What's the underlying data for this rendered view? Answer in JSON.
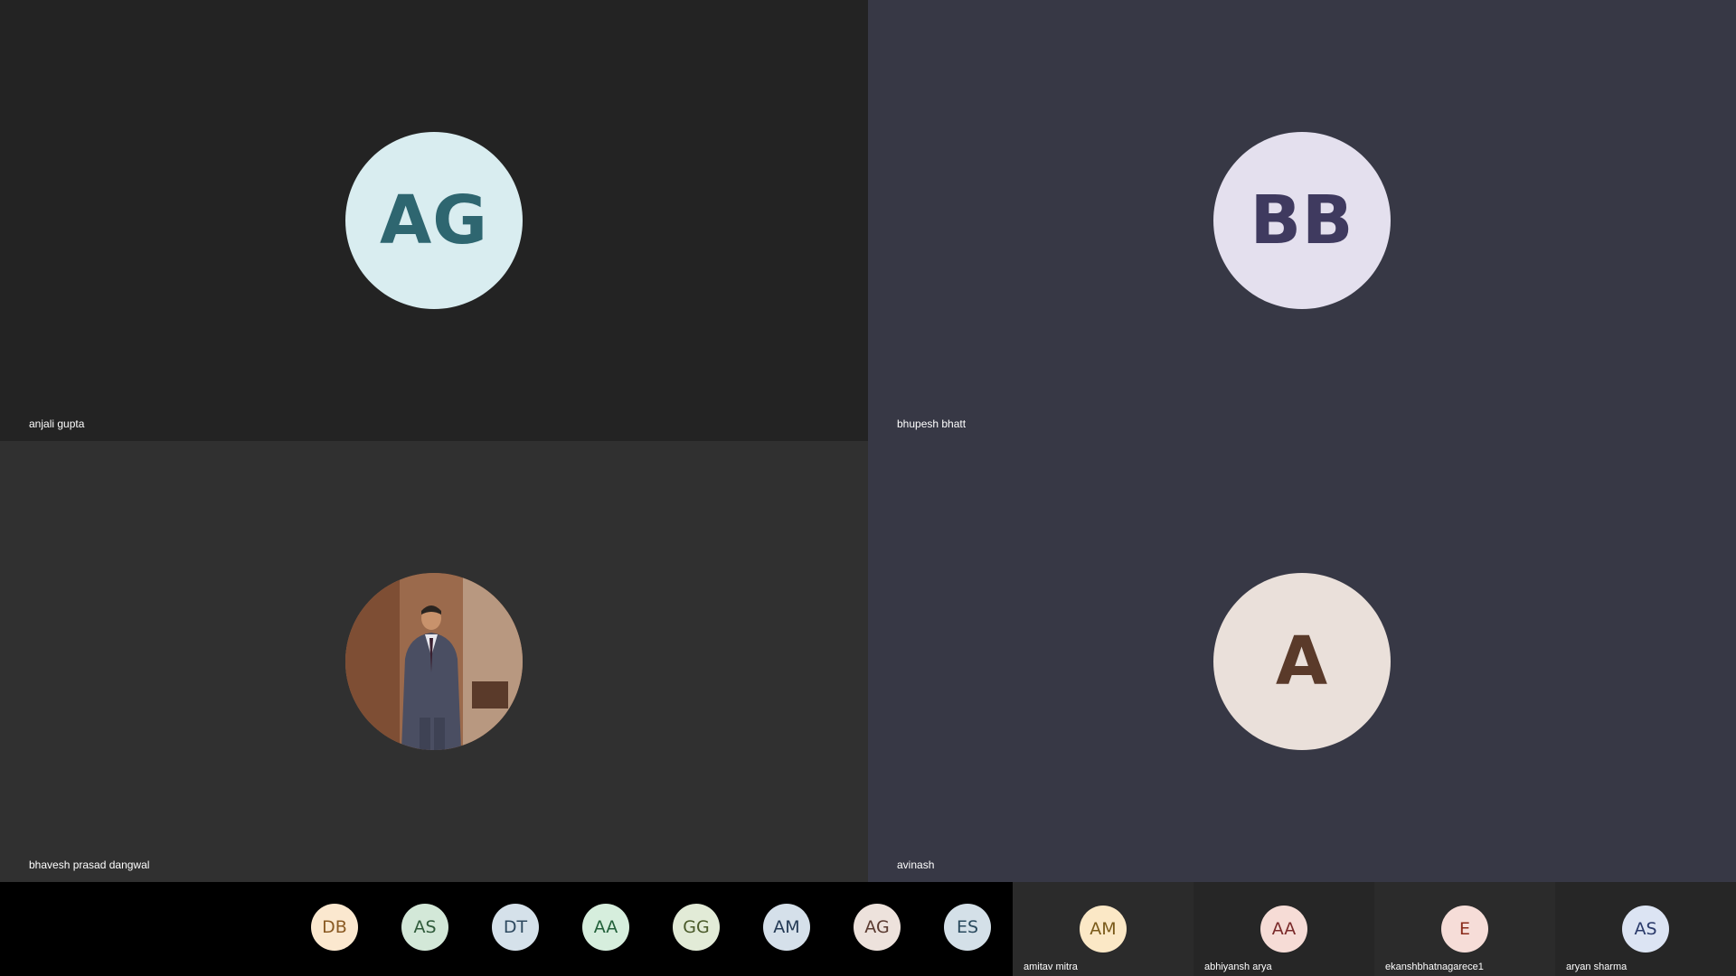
{
  "tiles": [
    {
      "name": "anjali gupta",
      "initials": "AG",
      "avatar_bg": "#d9edf0",
      "avatar_fg": "#2e6670",
      "tile_bg": "#232323"
    },
    {
      "name": "bhupesh bhatt",
      "initials": "BB",
      "avatar_bg": "#e4e0ee",
      "avatar_fg": "#3f3a5f",
      "tile_bg": "#373845"
    },
    {
      "name": "bhavesh prasad dangwal",
      "initials": "",
      "avatar_type": "photo",
      "tile_bg": "#303030"
    },
    {
      "name": "avinash",
      "initials": "A",
      "avatar_bg": "#eae0da",
      "avatar_fg": "#5a3a2a",
      "tile_bg": "#373845"
    }
  ],
  "overflow_avatars": [
    {
      "initials": "DB",
      "bg": "#fbe8cf",
      "fg": "#8a5a23"
    },
    {
      "initials": "AS",
      "bg": "#d3e8d8",
      "fg": "#2f5a3a"
    },
    {
      "initials": "DT",
      "bg": "#d5e1ea",
      "fg": "#2f4a60"
    },
    {
      "initials": "AA",
      "bg": "#d6eedd",
      "fg": "#22603a"
    },
    {
      "initials": "GG",
      "bg": "#e2ebd7",
      "fg": "#4a5a2a"
    },
    {
      "initials": "AM",
      "bg": "#d5e0ea",
      "fg": "#243a55"
    },
    {
      "initials": "AG",
      "bg": "#ede2dc",
      "fg": "#5a3a30"
    },
    {
      "initials": "ES",
      "bg": "#d4e0e8",
      "fg": "#2a4a5e"
    }
  ],
  "named_mini_tiles": [
    {
      "name": "amitav mitra",
      "initials": "AM",
      "bg": "#fbe8c6",
      "fg": "#7a5a1a",
      "tile_bg": "#2b2b2b"
    },
    {
      "name": "abhiyansh arya",
      "initials": "AA",
      "bg": "#f6dcd6",
      "fg": "#7a2a2a",
      "tile_bg": "#2b2b2b"
    },
    {
      "name": "ekanshbhatnagarece1",
      "initials": "E",
      "bg": "#f6ddd8",
      "fg": "#8a2a1a",
      "tile_bg": "#2b2b2b"
    },
    {
      "name": "aryan sharma",
      "initials": "AS",
      "bg": "#dce4f3",
      "fg": "#2a3a6a",
      "tile_bg": "#2b2b2b"
    }
  ]
}
